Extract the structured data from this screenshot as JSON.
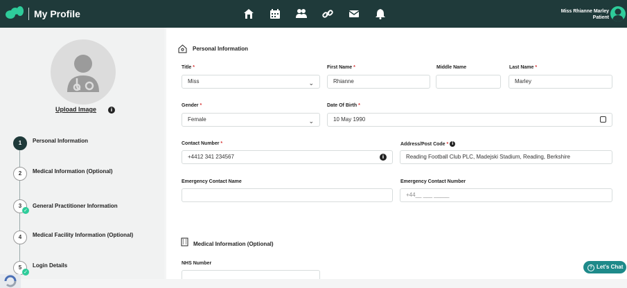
{
  "header": {
    "title": "My Profile",
    "user_name": "Miss Rhianne Marley",
    "user_role": "Patient",
    "nav_icons": [
      "home-icon",
      "calendar-icon",
      "people-icon",
      "link-icon",
      "mail-icon",
      "bell-icon"
    ]
  },
  "sidebar": {
    "upload_label": "Upload Image",
    "info_glyph": "i",
    "steps": [
      {
        "num": "1",
        "label": "Personal Information",
        "state": "active"
      },
      {
        "num": "2",
        "label": "Medical Information (Optional)",
        "state": "pending"
      },
      {
        "num": "3",
        "label": "General Practitioner Information",
        "state": "done"
      },
      {
        "num": "4",
        "label": "Medical Facility Information (Optional)",
        "state": "pending"
      },
      {
        "num": "5",
        "label": "Login Details",
        "state": "done"
      }
    ],
    "check_glyph": "✓"
  },
  "personal": {
    "heading": "Personal Information",
    "title_label": "Title",
    "title_value": "Miss",
    "first_name_label": "First Name",
    "first_name_value": "Rhianne",
    "middle_name_label": "Middle Name",
    "middle_name_value": "",
    "last_name_label": "Last Name",
    "last_name_value": "Marley",
    "gender_label": "Gender",
    "gender_value": "Female",
    "dob_label": "Date Of Birth",
    "dob_value": "10 May 1990",
    "contact_label": "Contact Number",
    "contact_value": "+4412 341 234567",
    "address_label": "Address/Post Code",
    "address_value": "Reading Football Club PLC, Madejski Stadium, Reading, Berkshire",
    "emergency_name_label": "Emergency Contact Name",
    "emergency_name_value": "",
    "emergency_number_label": "Emergency Contact Number",
    "emergency_number_value": "+44__ ___ _____",
    "required_mark": "*",
    "chevron": "⌄"
  },
  "medical": {
    "heading": "Medical Information (Optional)",
    "nhs_label": "NHS Number",
    "nhs_value": ""
  },
  "chat": {
    "label": "Let's Chat",
    "glyph": "?"
  },
  "colors": {
    "topbar": "#1f3a3a",
    "accent": "#2ecc9a",
    "chat": "#1e8a8a",
    "required": "#d63030"
  }
}
